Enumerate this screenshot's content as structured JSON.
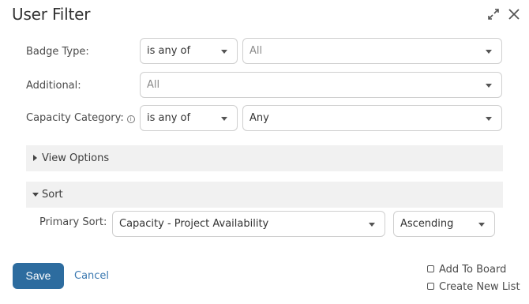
{
  "dialog": {
    "title": "User Filter"
  },
  "icons": {
    "expand": "expand-arrows-icon",
    "close": "close-x-icon",
    "info": "info-circle-icon"
  },
  "filters": {
    "badge_type": {
      "label": "Badge Type:",
      "operator": "is any of",
      "value": "All"
    },
    "additional": {
      "label": "Additional:",
      "value": "All"
    },
    "capacity_category": {
      "label": "Capacity Category:",
      "info_glyph": "i",
      "operator": "is any of",
      "value": "Any"
    }
  },
  "sections": {
    "view_options": {
      "label": "View Options",
      "expanded": false
    },
    "sort": {
      "label": "Sort",
      "expanded": true
    }
  },
  "sort": {
    "primary_label": "Primary Sort:",
    "primary_value": "Capacity - Project Availability",
    "direction": "Ascending"
  },
  "footer": {
    "save_label": "Save",
    "cancel_label": "Cancel",
    "add_to_board_label": "Add To Board",
    "create_new_list_label": "Create New List"
  },
  "colors": {
    "primary_button": "#2d6c9f",
    "link": "#3a78b0",
    "section_bg": "#f1f1f1"
  }
}
